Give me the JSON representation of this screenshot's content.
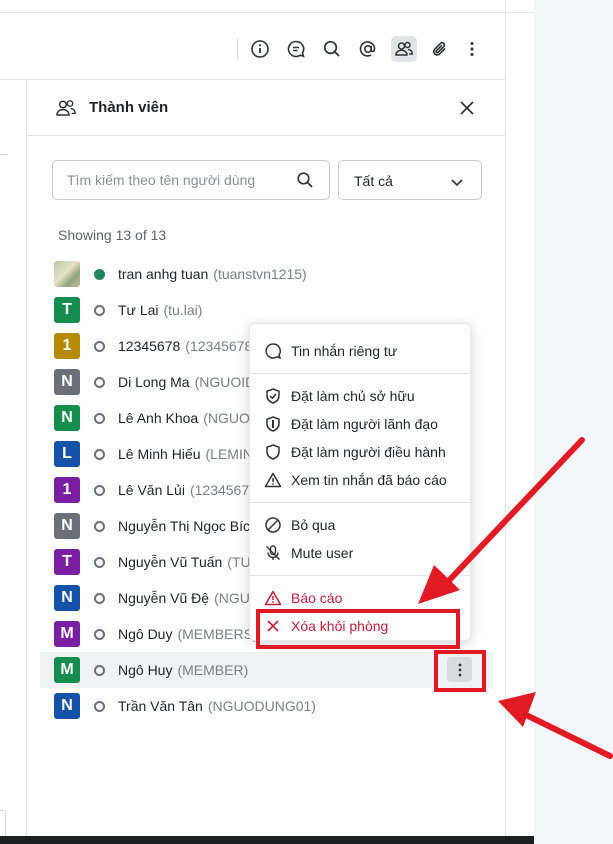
{
  "toolbar": {
    "buttons": [
      "info-icon",
      "thread-icon",
      "search-icon",
      "mention-icon",
      "members-icon",
      "attachment-icon",
      "more-icon"
    ]
  },
  "panel": {
    "title": "Thành viên",
    "search": {
      "placeholder": "Tìm kiếm theo tên người dùng",
      "value": ""
    },
    "filter": {
      "selected": "Tất cả"
    },
    "showing": "Showing 13 of 13"
  },
  "members": [
    {
      "initial": "",
      "color": "",
      "photo": true,
      "name": "tran anhg tuan",
      "username": "(tuanstvn1215)",
      "status": "online"
    },
    {
      "initial": "T",
      "color": "#158d4f",
      "name": "Tư Lai",
      "username": "(tu.lai)",
      "status": "offline"
    },
    {
      "initial": "1",
      "color": "#b58a00",
      "name": "12345678",
      "username": "(12345678",
      "status": "offline"
    },
    {
      "initial": "N",
      "color": "#6b7078",
      "name": "Di Long Ma",
      "username": "(NGUOIDUNG",
      "status": "offline"
    },
    {
      "initial": "N",
      "color": "#158d4f",
      "name": "Lê Anh Khoa",
      "username": "(NGUOIDUNG",
      "status": "offline"
    },
    {
      "initial": "L",
      "color": "#1452a8",
      "name": "Lê Minh Hiếu",
      "username": "(LEMINHHIEU",
      "status": "offline"
    },
    {
      "initial": "1",
      "color": "#7a1fa2",
      "name": "Lê Văn Lủi",
      "username": "(1234567)",
      "status": "offline"
    },
    {
      "initial": "N",
      "color": "#6b7078",
      "name": "Nguyễn Thị Ngọc Bích",
      "username": "",
      "status": "offline"
    },
    {
      "initial": "T",
      "color": "#7a1fa2",
      "name": "Nguyễn Vũ Tuấn",
      "username": "(TUAN",
      "status": "offline"
    },
    {
      "initial": "N",
      "color": "#1452a8",
      "name": "Nguyễn Vũ Đệ",
      "username": "(NGUOIDUNG",
      "status": "offline"
    },
    {
      "initial": "M",
      "color": "#7a1fa2",
      "name": "Ngô Duy",
      "username": "(MEMBERS)",
      "status": "offline"
    },
    {
      "initial": "M",
      "color": "#158d4f",
      "name": "Ngô Huy",
      "username": "(MEMBER)",
      "status": "offline"
    },
    {
      "initial": "N",
      "color": "#1452a8",
      "name": "Trần Văn Tân",
      "username": "(NGUODUNG01)",
      "status": "offline"
    }
  ],
  "menu": {
    "direct_message": "Tin nhắn riêng tư",
    "set_owner": "Đặt làm chủ sở hữu",
    "set_leader": "Đặt làm người lãnh đạo",
    "set_moderator": "Đặt làm người điều hành",
    "view_reported": "Xem tin nhắn đã báo cáo",
    "ignore": "Bỏ qua",
    "mute_user": "Mute user",
    "report": "Báo cáo",
    "remove_from_room": "Xóa khỏi phòng"
  },
  "colors": {
    "danger": "#c21d3a",
    "annotation": "#e01b24",
    "online": "#21865d"
  }
}
